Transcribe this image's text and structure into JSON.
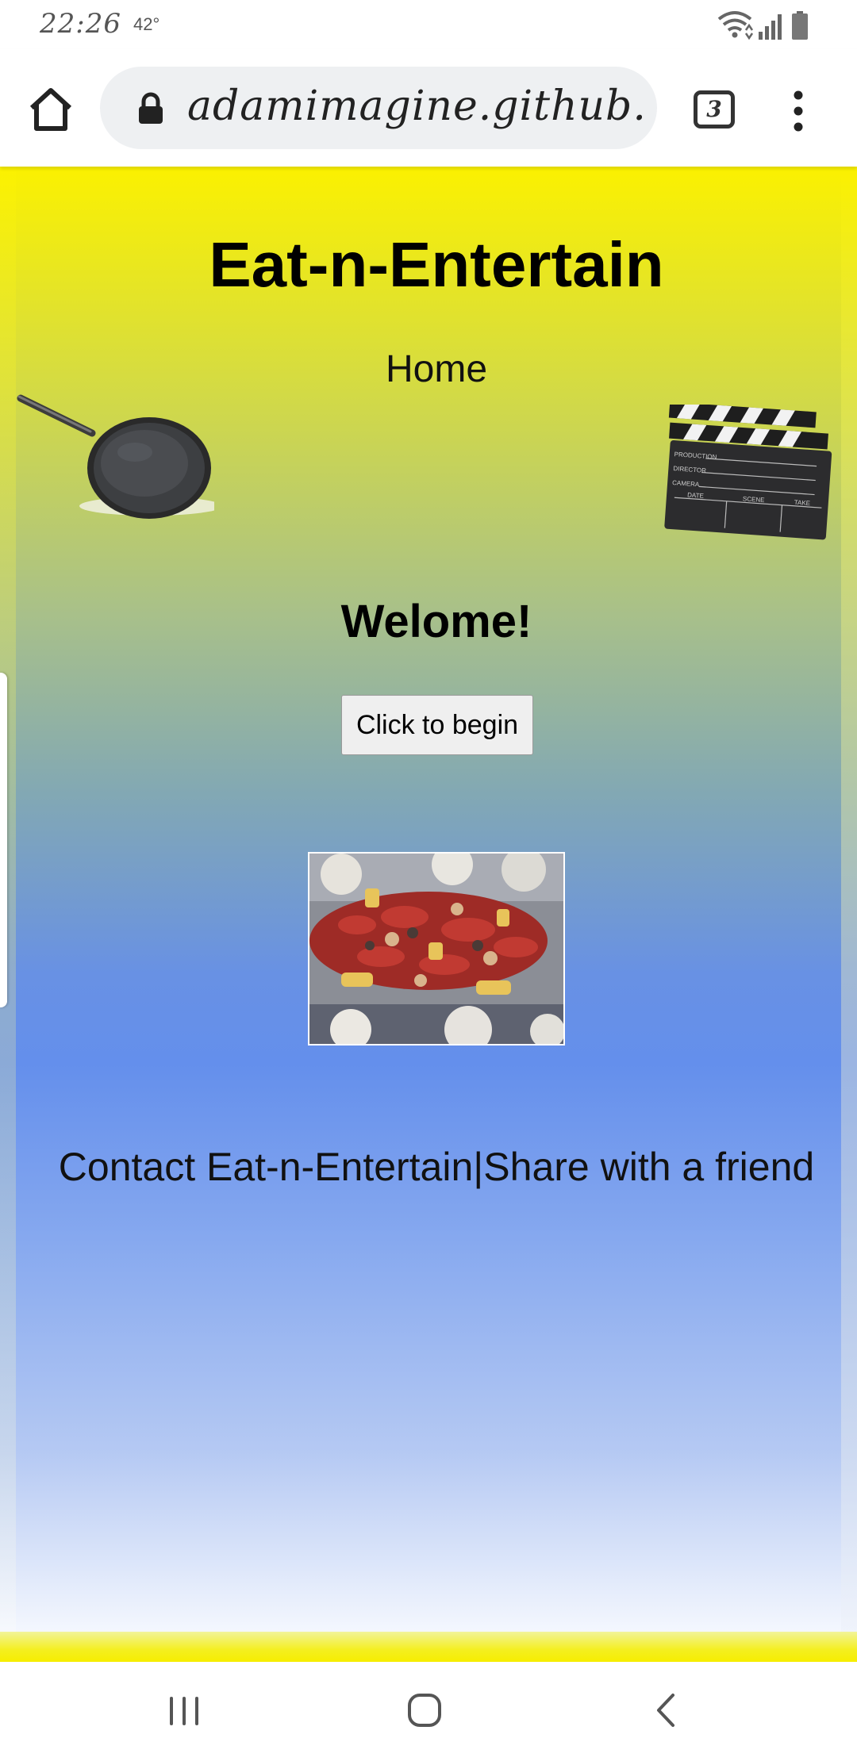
{
  "status_bar": {
    "time": "22:26",
    "temperature": "42°",
    "icons": [
      "wifi-icon",
      "signal-icon",
      "battery-icon"
    ]
  },
  "browser": {
    "url": "adamimagine.github.io",
    "tab_count": "3",
    "icons": [
      "home-icon",
      "lock-icon",
      "tabs-icon",
      "menu-icon"
    ]
  },
  "page": {
    "title": "Eat-n-Entertain",
    "nav_home": "Home",
    "welcome": "Welome!",
    "begin_button": "Click to begin",
    "images": [
      "frying-pan",
      "film-clapperboard",
      "crawfish-boil-photo"
    ],
    "footer": {
      "contact": "Contact Eat-n-Entertain",
      "separator": "|",
      "share": "Share with a friend"
    },
    "colors": {
      "gradient_top": "#fbf100",
      "gradient_middle": "#648fec",
      "gradient_bottom": "#ffffff"
    }
  },
  "nav_bar": {
    "buttons": [
      "recent-apps",
      "home",
      "back"
    ]
  }
}
